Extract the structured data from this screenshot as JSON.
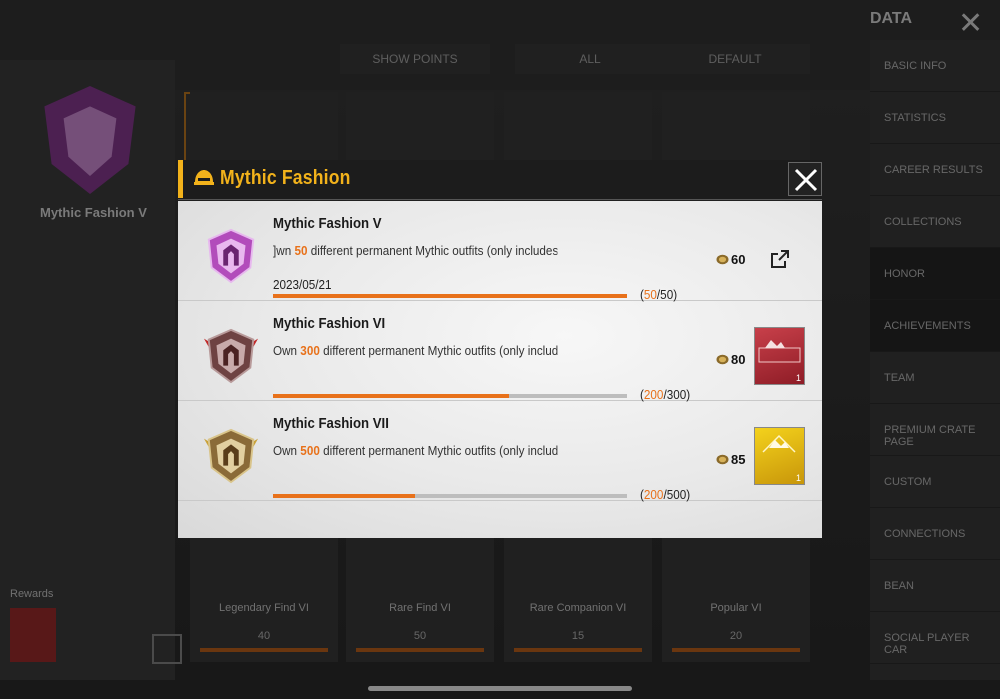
{
  "background": {
    "data_title": "DATA",
    "left_badge_name": "Mythic Fashion V",
    "rewards_label": "Rewards",
    "filters": [
      "SHOW POINTS",
      "ALL",
      "DEFAULT"
    ],
    "cards": [
      {
        "title": "Legendary Find VI",
        "points": "40"
      },
      {
        "title": "Rare Find VI",
        "points": "50"
      },
      {
        "title": "Rare Companion VI",
        "points": "15"
      },
      {
        "title": "Popular VI",
        "points": "20"
      }
    ],
    "sidebar_items": [
      "BASIC INFO",
      "STATISTICS",
      "CAREER RESULTS",
      "COLLECTIONS",
      "HONOR",
      "ACHIEVEMENTS",
      "TEAM",
      "PREMIUM CRATE PAGE",
      "CUSTOM",
      "CONNECTIONS",
      "BEAN",
      "SOCIAL PLAYER CAR"
    ]
  },
  "modal": {
    "title": "Mythic Fashion",
    "accent_color": "#f2b21b",
    "highlight_color": "#e8711a",
    "icons": {
      "header": "helmet-icon",
      "close": "close-icon",
      "share": "share-icon",
      "points": "coin-icon"
    },
    "achievements": [
      {
        "name": "Mythic Fashion V",
        "desc_pre": "]wn ",
        "desc_num": "50",
        "desc_post": " different permanent Mythic outfits (only includes outfit",
        "date": "2023/05/21",
        "points": "60",
        "progress_current": "50",
        "progress_total": "/50)",
        "progress_open": "(",
        "progress_fraction": 1.0,
        "badge_color": "#c054c8",
        "reward": null
      },
      {
        "name": "Mythic Fashion VI",
        "desc_pre": "Own ",
        "desc_num": "300",
        "desc_post": " different permanent Mythic outfits (only includes out",
        "date": "",
        "points": "80",
        "progress_current": "200",
        "progress_total": "/300)",
        "progress_open": "(",
        "progress_fraction": 0.667,
        "badge_color": "#7a4a4a",
        "reward": {
          "color": "#b32a35",
          "qty": "1"
        }
      },
      {
        "name": "Mythic Fashion VII",
        "desc_pre": "Own ",
        "desc_num": "500",
        "desc_post": " different permanent Mythic outfits (only includes out",
        "date": "",
        "points": "85",
        "progress_current": "200",
        "progress_total": "/500)",
        "progress_open": "(",
        "progress_fraction": 0.4,
        "badge_color": "#8a6a38",
        "reward": {
          "color": "#e5b90e",
          "qty": "1"
        }
      }
    ]
  }
}
